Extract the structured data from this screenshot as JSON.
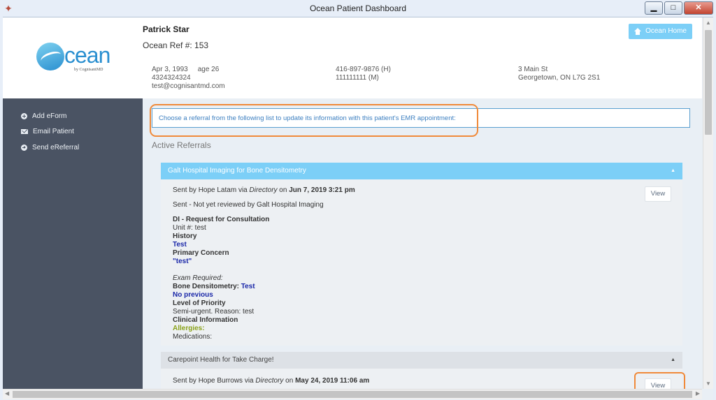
{
  "window": {
    "title": "Ocean Patient Dashboard",
    "min": "▁",
    "max": "□",
    "close": "✕"
  },
  "header": {
    "logo_word": "cean",
    "logo_by": "by CognisantMD",
    "patient_name": "Patrick Star",
    "ocean_ref": "Ocean Ref #: 153",
    "dob": "Apr 3, 1993",
    "age": "age 26",
    "health_number": "4324324324",
    "email": "test@cognisantmd.com",
    "phone_home": "416-897-9876 (H)",
    "phone_mobile": "111111111 (M)",
    "address_line1": "3 Main St",
    "address_line2": "Georgetown, ON L7G 2S1",
    "home_button": "Ocean Home"
  },
  "sidebar": {
    "items": [
      {
        "label": "Add eForm",
        "icon": "plus-circle-icon"
      },
      {
        "label": "Email Patient",
        "icon": "envelope-icon"
      },
      {
        "label": "Send eReferral",
        "icon": "arrow-circle-icon"
      }
    ]
  },
  "main": {
    "notice": "Choose a referral from the following list to update its information with this patient's EMR appointment:",
    "section_title": "Active Referrals",
    "referral1": {
      "title": "Galt Hospital Imaging for Bone Densitometry",
      "sent_prefix": "Sent by Hope Latam via ",
      "sent_via": "Directory",
      "sent_on": " on ",
      "sent_date": "Jun 7, 2019 3:21 pm",
      "status": "Sent - Not yet reviewed by Galt Hospital Imaging",
      "form_title": "DI - Request for Consultation",
      "unit": "Unit #: test",
      "history_label": "History",
      "history_value": "Test",
      "concern_label": "Primary Concern",
      "concern_value": "\"test\"",
      "exam_required": "Exam Required:",
      "bone_label": "Bone Densitometry: ",
      "bone_value": "Test",
      "no_previous": "No previous",
      "priority_label": "Level of Priority",
      "priority_value": "Semi-urgent. Reason: test",
      "clinical_label": "Clinical Information",
      "allergies_label": "Allergies:",
      "medications_label": "Medications:",
      "view_label": "View"
    },
    "referral2": {
      "title": "Carepoint Health for Take Charge!",
      "sent_prefix": "Sent by Hope Burrows via ",
      "sent_via": "Directory",
      "sent_on": " on ",
      "sent_date": "May 24, 2019 11:06 am",
      "view_label": "View"
    }
  },
  "colors": {
    "accent": "#7ccff7",
    "sidebar": "#4a5363",
    "highlight": "#f08a3a",
    "notice_text": "#3c7fc0"
  }
}
